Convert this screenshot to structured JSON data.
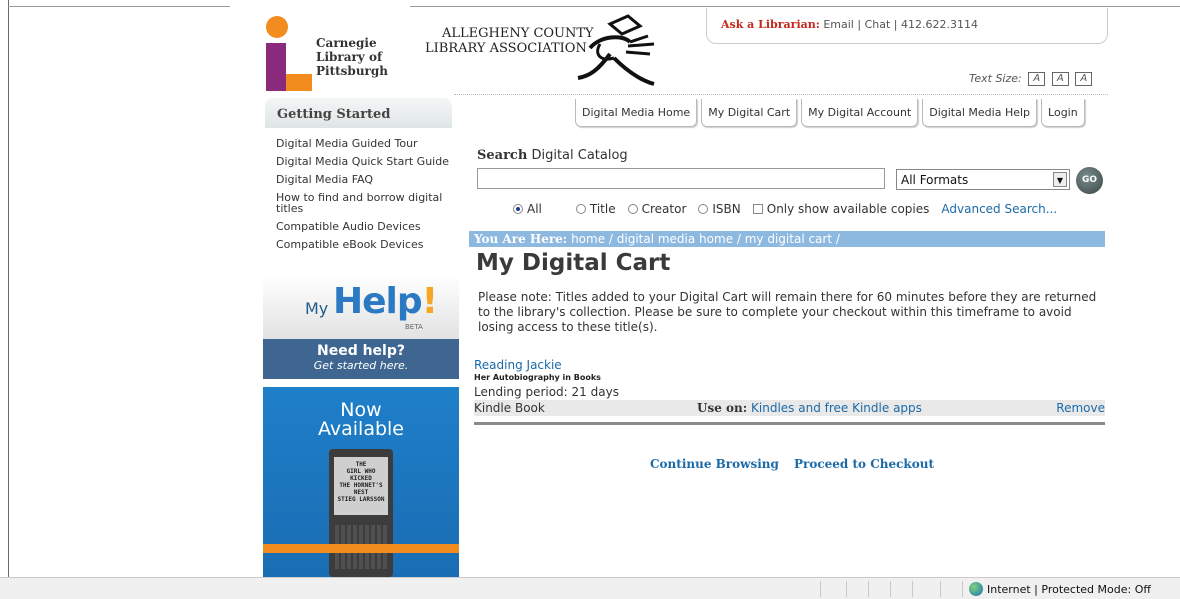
{
  "header": {
    "clp_logo_lines": [
      "Carnegie",
      "Library of",
      "Pittsburgh"
    ],
    "acla_logo_lines": [
      "ALLEGHENY COUNTY",
      "LIBRARY ASSOCIATION"
    ],
    "ask_label": "Ask a Librarian:",
    "ask_email": "Email",
    "ask_chat": "Chat",
    "ask_phone": "412.622.3114",
    "text_size_label": "Text Size:",
    "text_size_buttons": [
      "A",
      "A",
      "A"
    ]
  },
  "tabs": [
    {
      "label": "Digital Media Home"
    },
    {
      "label": "My Digital Cart"
    },
    {
      "label": "My Digital Account"
    },
    {
      "label": "Digital Media Help"
    },
    {
      "label": "Login"
    }
  ],
  "sidebar": {
    "heading": "Getting Started",
    "links": [
      "Digital Media Guided Tour",
      "Digital Media Quick Start Guide",
      "Digital Media FAQ",
      "How to find and borrow digital titles",
      "Compatible Audio Devices",
      "Compatible eBook Devices"
    ],
    "myhelp": {
      "my": "My",
      "help": "Help",
      "bang": "!",
      "beta": "BETA",
      "line1": "Need help?",
      "line2": "Get started here."
    },
    "promo": {
      "line1": "Now",
      "line2": "Available",
      "book_lines": [
        "THE",
        "GIRL WHO",
        "KICKED",
        "THE HORNET'S",
        "NEST",
        "STIEG LARSSON"
      ]
    }
  },
  "search": {
    "title_bold": "Search",
    "title_rest": "Digital Catalog",
    "input_value": "",
    "format_selected": "All Formats",
    "go_label": "GO",
    "options": [
      "All",
      "Title",
      "Creator",
      "ISBN"
    ],
    "selected_option": "All",
    "available_only_label": "Only show available copies",
    "advanced_label": "Advanced Search..."
  },
  "breadcrumb": {
    "label": "You Are Here:",
    "path": "home / digital media home / my digital cart /"
  },
  "page_title": "My Digital Cart",
  "note": "Please note: Titles added to your Digital Cart will remain there for 60 minutes before they are returned to the library's collection. Please be sure to complete your checkout within this timeframe to avoid losing access to these title(s).",
  "cart_item": {
    "title": "Reading Jackie",
    "subtitle": "Her Autobiography in Books",
    "lending": "Lending period: 21 days",
    "format": "Kindle Book",
    "use_on_label": "Use on:",
    "use_on_value": "Kindles and free Kindle apps",
    "remove_label": "Remove"
  },
  "actions": {
    "continue": "Continue Browsing",
    "checkout": "Proceed to Checkout"
  },
  "statusbar": {
    "zone": "Internet | Protected Mode: Off"
  }
}
